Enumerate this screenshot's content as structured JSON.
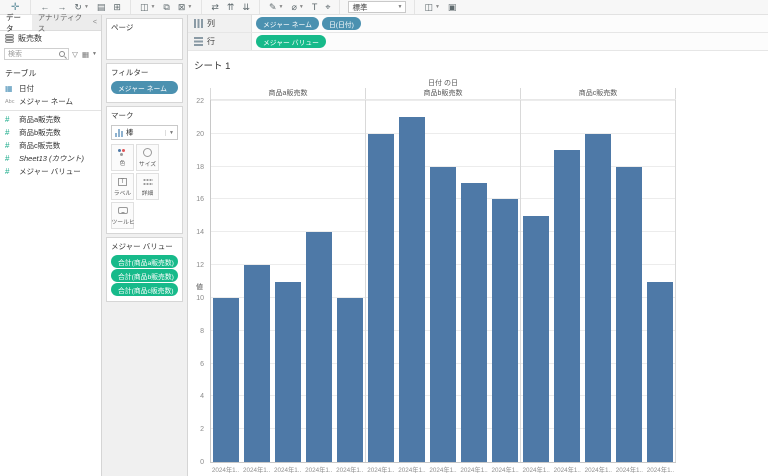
{
  "toolbar": {
    "fit_selector": "標準",
    "groups": [
      [
        {
          "name": "back",
          "glyph": "←"
        },
        {
          "name": "forward",
          "glyph": "→"
        },
        {
          "name": "replay",
          "glyph": "↻",
          "dropdown": true
        },
        {
          "name": "save",
          "glyph": "▤"
        },
        {
          "name": "new-data-source",
          "glyph": "⊞"
        }
      ],
      [
        {
          "name": "new-worksheet",
          "glyph": "◫",
          "dropdown": true
        },
        {
          "name": "duplicate",
          "glyph": "⧉"
        },
        {
          "name": "clear-sheet",
          "glyph": "⊠",
          "dropdown": true
        }
      ],
      [
        {
          "name": "swap-rows-columns",
          "glyph": "⇄"
        },
        {
          "name": "sort-ascending",
          "glyph": "⇈"
        },
        {
          "name": "sort-descending",
          "glyph": "⇊"
        }
      ],
      [
        {
          "name": "highlight",
          "glyph": "✎",
          "dropdown": true
        },
        {
          "name": "group-members",
          "glyph": "⌀",
          "dropdown": true
        },
        {
          "name": "show-mark-labels",
          "glyph": "T"
        },
        {
          "name": "fix-axes",
          "glyph": "⌖"
        }
      ]
    ],
    "right_icons": [
      {
        "name": "show-me",
        "glyph": "◫",
        "dropdown": true
      },
      {
        "name": "presentation-mode",
        "glyph": "▣"
      }
    ]
  },
  "sidebar": {
    "tabs": {
      "data": "データ",
      "analytics": "アナリティクス",
      "collapse": "<"
    },
    "datasource": "販売数",
    "search_placeholder": "検索",
    "table_section": "テーブル",
    "fields": [
      {
        "name": "日付",
        "icon": "calendar"
      },
      {
        "name": "メジャー ネーム",
        "icon": "abc",
        "divider_after": true
      },
      {
        "name": "商品a販売数",
        "icon": "hash"
      },
      {
        "name": "商品b販売数",
        "icon": "hash"
      },
      {
        "name": "商品c販売数",
        "icon": "hash"
      },
      {
        "name": "Sheet13 (カウント)",
        "icon": "hash",
        "italic": true
      },
      {
        "name": "メジャー バリュー",
        "icon": "hash"
      }
    ]
  },
  "cards": {
    "pages": {
      "title": "ページ"
    },
    "filters": {
      "title": "フィルター",
      "pills": [
        {
          "label": "メジャー ネーム",
          "color": "blue"
        }
      ]
    },
    "marks": {
      "title": "マーク",
      "mark_type": "棒",
      "buttons": [
        {
          "name": "color",
          "label": "色"
        },
        {
          "name": "size",
          "label": "サイズ"
        },
        {
          "name": "label",
          "label": "ラベル"
        },
        {
          "name": "detail",
          "label": "詳細"
        },
        {
          "name": "tooltip",
          "label": "ツールヒ..."
        }
      ]
    },
    "measure_values": {
      "title": "メジャー バリュー",
      "pills": [
        "合計(商品a販売数)",
        "合計(商品b販売数)",
        "合計(商品c販売数)"
      ]
    }
  },
  "shelves": {
    "columns": {
      "label": "列",
      "pills": [
        {
          "label": "メジャー ネーム",
          "color": "blue"
        },
        {
          "label": "日(日付)",
          "color": "blue"
        }
      ]
    },
    "rows": {
      "label": "行",
      "pills": [
        {
          "label": "メジャー バリュー",
          "color": "green"
        }
      ]
    }
  },
  "sheet": {
    "title": "シート 1"
  },
  "chart_data": {
    "type": "bar",
    "title": "日付 の日",
    "ylabel": "値",
    "ylim": [
      0,
      22
    ],
    "yticks": [
      0,
      2,
      4,
      6,
      8,
      10,
      12,
      14,
      16,
      18,
      20,
      22
    ],
    "grid": true,
    "bar_color": "#4e79a7",
    "panels": [
      {
        "title": "商品a販売数",
        "categories": [
          "2024年1..",
          "2024年1..",
          "2024年1..",
          "2024年1..",
          "2024年1.."
        ],
        "values": [
          10,
          12,
          11,
          14,
          10
        ]
      },
      {
        "title": "商品b販売数",
        "categories": [
          "2024年1..",
          "2024年1..",
          "2024年1..",
          "2024年1..",
          "2024年1.."
        ],
        "values": [
          20,
          21,
          18,
          17,
          16
        ]
      },
      {
        "title": "商品c販売数",
        "categories": [
          "2024年1..",
          "2024年1..",
          "2024年1..",
          "2024年1..",
          "2024年1.."
        ],
        "values": [
          15,
          19,
          20,
          18,
          11
        ]
      }
    ]
  },
  "colors": {
    "pill_blue": "#4b91b0",
    "pill_green": "#17ba8a",
    "bar": "#4e79a7"
  }
}
